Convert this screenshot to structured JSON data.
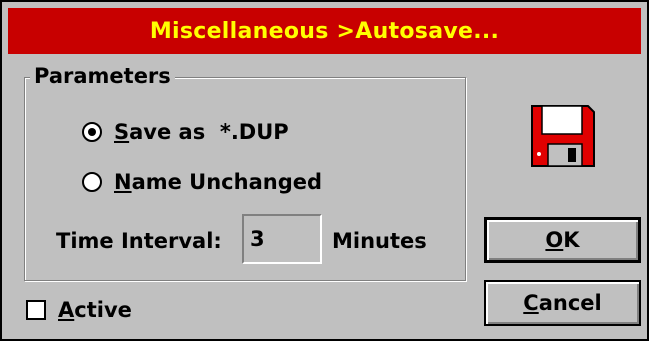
{
  "window": {
    "title": "Miscellaneous >Autosave..."
  },
  "parameters": {
    "group_label": "Parameters",
    "options": [
      {
        "accel": "S",
        "rest": "ave as  *.DUP",
        "selected": true
      },
      {
        "accel": "N",
        "rest": "ame Unchanged",
        "selected": false
      }
    ],
    "time_interval_label": "Time Interval:",
    "time_interval_value": "3",
    "time_interval_unit": "Minutes"
  },
  "active": {
    "accel": "A",
    "rest": "ctive",
    "checked": false
  },
  "buttons": {
    "ok_accel": "O",
    "ok_rest": "K",
    "cancel_accel": "C",
    "cancel_rest": "ancel"
  },
  "icon": {
    "name": "floppy-disk-icon"
  },
  "colors": {
    "titlebar": "#c80000",
    "title_text": "#ffff00",
    "face": "#c0c0c0",
    "disk": "#e00000"
  }
}
